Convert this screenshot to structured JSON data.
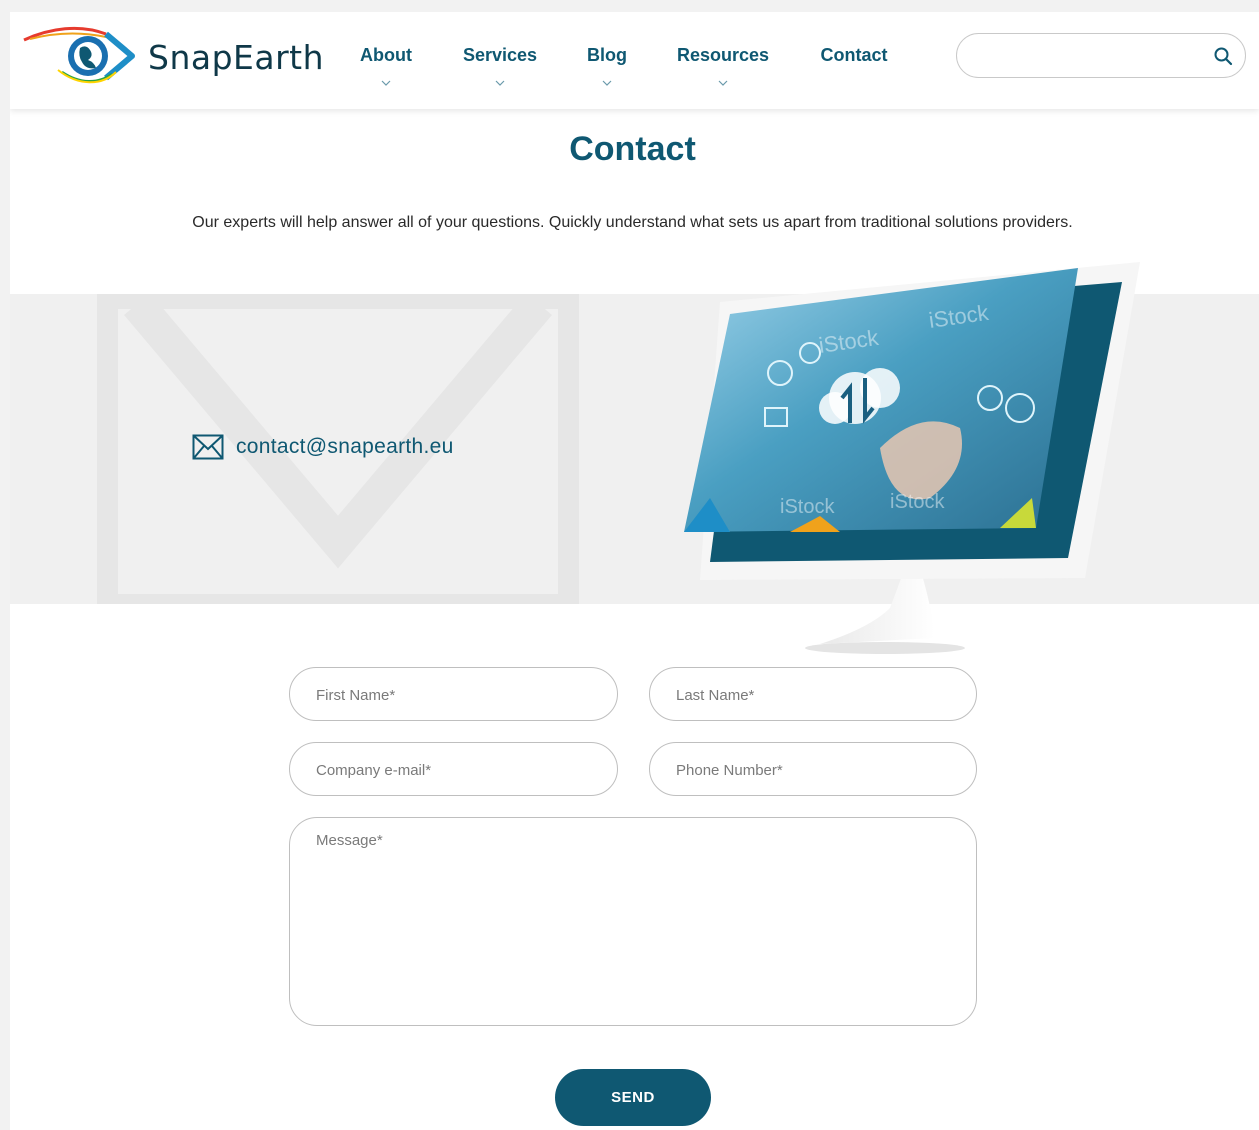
{
  "brand": {
    "name": "SnapEarth",
    "accent": "#0f5872",
    "logo_icon": "globe-eye-icon"
  },
  "nav": {
    "items": [
      {
        "label": "About"
      },
      {
        "label": "Services"
      },
      {
        "label": "Blog"
      },
      {
        "label": "Resources"
      },
      {
        "label": "Contact"
      }
    ]
  },
  "search": {
    "placeholder": "",
    "icon": "search-icon"
  },
  "main": {
    "title": "Contact",
    "intro": "Our experts will help answer all of your questions. Quickly understand what sets us apart from traditional solutions providers.",
    "email": "contact@snapearth.eu",
    "email_icon": "envelope-icon",
    "image": {
      "watermark": "iStock"
    }
  },
  "form": {
    "first_name_placeholder": "First Name*",
    "last_name_placeholder": "Last Name*",
    "email_placeholder": "Company e-mail*",
    "phone_placeholder": "Phone Number*",
    "message_placeholder": "Message*",
    "send_label": "SEND"
  }
}
